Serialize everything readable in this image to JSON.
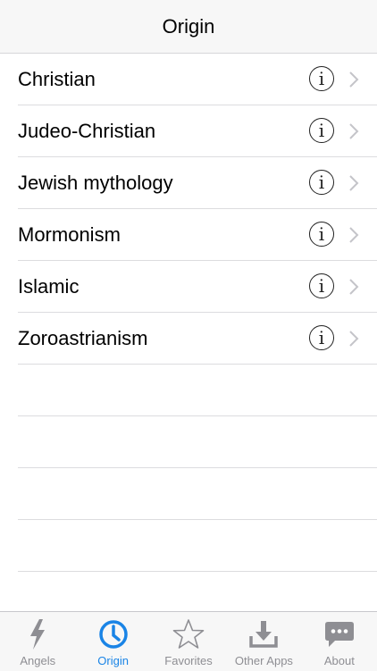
{
  "navbar": {
    "title": "Origin"
  },
  "origins": [
    {
      "label": "Christian"
    },
    {
      "label": "Judeo-Christian"
    },
    {
      "label": "Jewish mythology"
    },
    {
      "label": "Mormonism"
    },
    {
      "label": "Islamic"
    },
    {
      "label": "Zoroastrianism"
    }
  ],
  "info_glyph": "i",
  "tabs": [
    {
      "label": "Angels",
      "icon": "lightning-icon"
    },
    {
      "label": "Origin",
      "icon": "clock-icon",
      "active": true
    },
    {
      "label": "Favorites",
      "icon": "star-icon"
    },
    {
      "label": "Other Apps",
      "icon": "download-icon"
    },
    {
      "label": "About",
      "icon": "chat-bubble-icon"
    }
  ],
  "colors": {
    "accent": "#1a84e6",
    "inactive": "#8e8e93",
    "bar_bg": "#f7f7f7"
  }
}
